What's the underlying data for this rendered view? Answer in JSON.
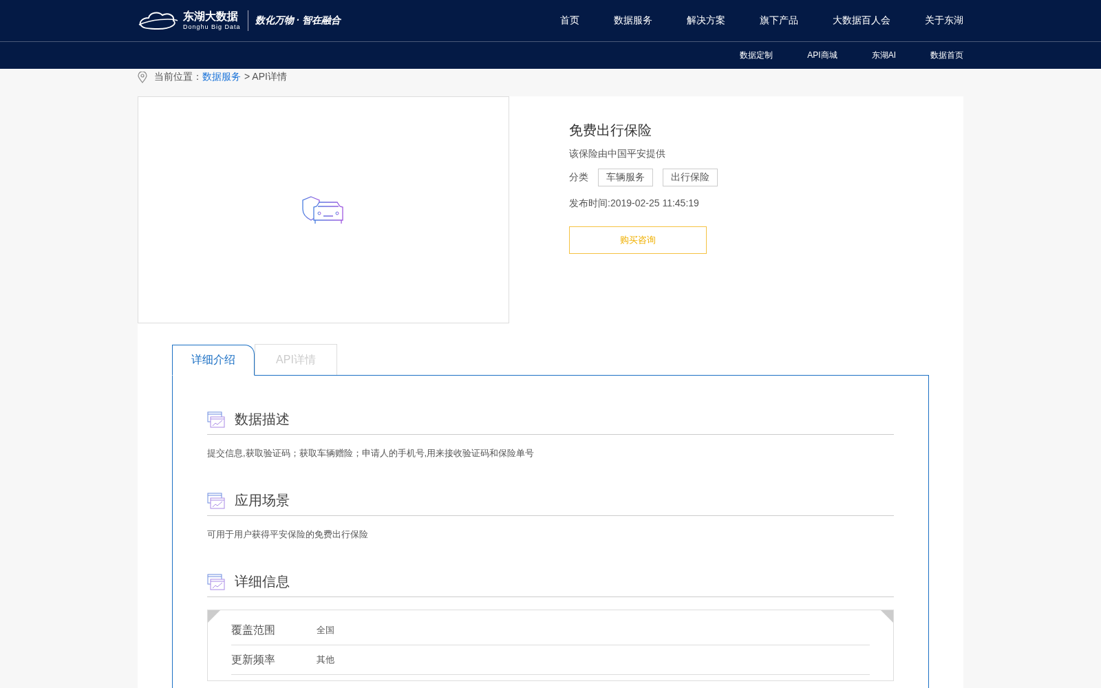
{
  "header": {
    "logo": {
      "name": "东湖大数据",
      "sub": "Donghu Big Data",
      "slogan": "数化万物 · 智在融合"
    },
    "nav": [
      "首页",
      "数据服务",
      "解决方案",
      "旗下产品",
      "大数据百人会",
      "关于东湖"
    ],
    "subnav": [
      "数据定制",
      "API商城",
      "东湖AI",
      "数据首页"
    ]
  },
  "breadcrumb": {
    "label": "当前位置：",
    "link": "数据服务",
    "current": "> API详情"
  },
  "product": {
    "title": "免费出行保险",
    "provider": "该保险由中国平安提供",
    "category_label": "分类",
    "tags": [
      "车辆服务",
      "出行保险"
    ],
    "published": "发布时间:2019-02-25 11:45:19",
    "button": "购买咨询"
  },
  "tabs": [
    {
      "label": "详细介绍",
      "selected": true
    },
    {
      "label": "API详情",
      "selected": false
    }
  ],
  "sections": [
    {
      "title": "数据描述",
      "text": "提交信息,获取验证码；获取车辆赠险；申请人的手机号,用来接收验证码和保险单号"
    },
    {
      "title": "应用场景",
      "text": "可用于用户获得平安保险的免费出行保险"
    },
    {
      "title": "详细信息",
      "details": [
        {
          "label": "覆盖范围",
          "value": "全国"
        },
        {
          "label": "更新频率",
          "value": "其他"
        }
      ]
    }
  ]
}
